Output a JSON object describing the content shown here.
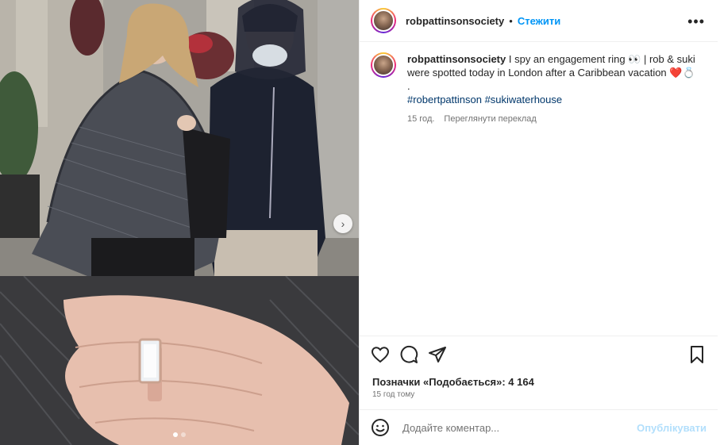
{
  "post": {
    "username": "robpattinsonsociety",
    "separator": "•",
    "follow_label": "Стежити",
    "more_icon": "more-options-icon"
  },
  "caption": {
    "username": "robpattinsonsociety",
    "text": " I spy an engagement ring 👀 | rob & suki were spotted today in London after a Caribbean vacation ❤️💍",
    "dot": ".",
    "tags": "#robertpattinson #sukiwaterhouse",
    "age": "15 год.",
    "translate_label": "Переглянути переклад"
  },
  "actions": {
    "like_icon": "heart-icon",
    "comment_icon": "comment-icon",
    "share_icon": "share-icon",
    "save_icon": "bookmark-icon",
    "likes_text": "Позначки «Подобається»: 4 164",
    "time_text": "15 год тому"
  },
  "comment": {
    "emoji_icon": "emoji-icon",
    "placeholder": "Додайте коментар...",
    "publish_label": "Опублікувати"
  },
  "carousel": {
    "total": 2,
    "active": 1
  },
  "colors": {
    "accent": "#0095f6",
    "link": "#00376b",
    "publish_disabled": "#b2dffc",
    "muted": "#737373"
  }
}
